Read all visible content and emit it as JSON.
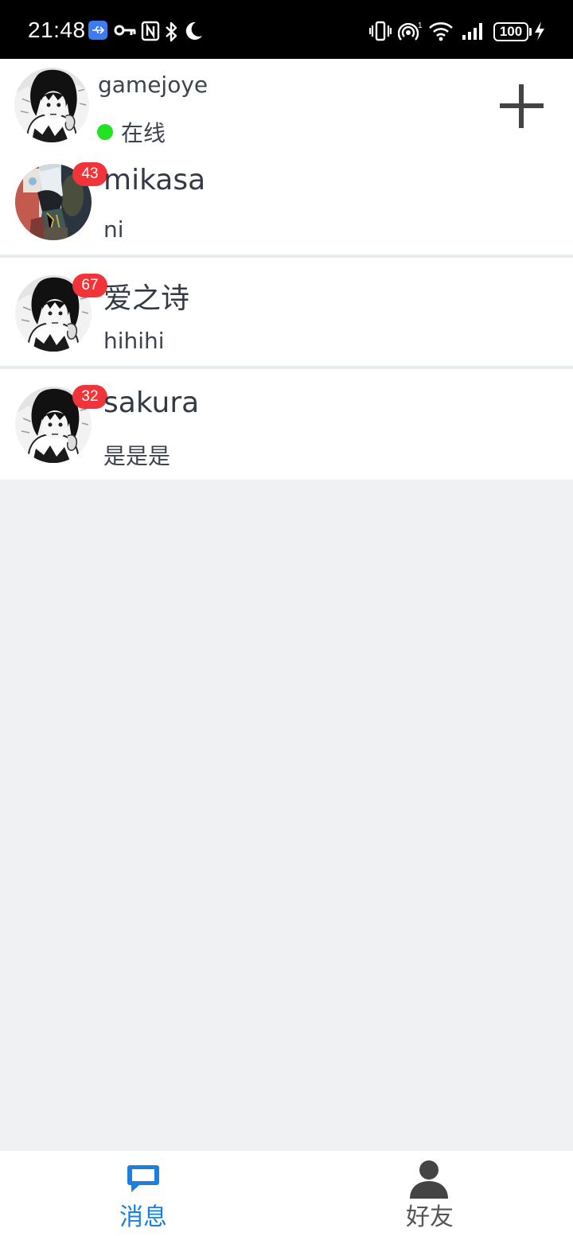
{
  "status_bar": {
    "time": "21:48",
    "battery": "100",
    "icons": [
      "usb-icon",
      "vpn-key-icon",
      "nfc-icon",
      "bluetooth-icon",
      "moon-icon",
      "vibrate-icon",
      "hotspot-icon",
      "wifi-icon",
      "signal-icon",
      "charging-icon"
    ]
  },
  "header": {
    "username": "gamejoye",
    "status": "在线",
    "status_color": "#22e222",
    "add_icon": "plus-icon"
  },
  "chats": [
    {
      "name": "mikasa",
      "last_message": "ni",
      "unread": "43"
    },
    {
      "name": "爱之诗",
      "last_message": "hihihi",
      "unread": "67"
    },
    {
      "name": "sakura",
      "last_message": "是是是",
      "unread": "32"
    }
  ],
  "tabs": [
    {
      "label": "消息",
      "icon": "message-icon",
      "active": true,
      "color": "#1a7fe0"
    },
    {
      "label": "好友",
      "icon": "person-icon",
      "active": false,
      "color": "#555555"
    }
  ],
  "colors": {
    "accent": "#1a7fe0",
    "badge": "#f1343a",
    "background": "#eff1f3"
  }
}
